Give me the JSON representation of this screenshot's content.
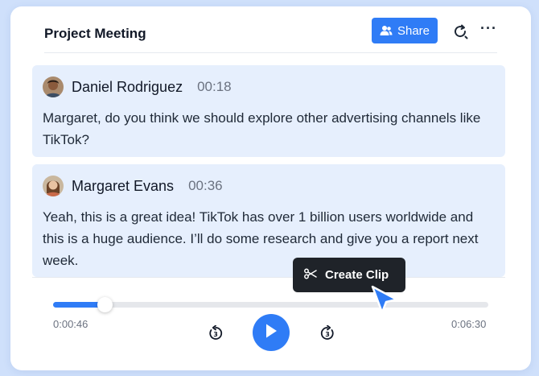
{
  "header": {
    "title": "Project Meeting",
    "share_label": "Share",
    "share_icon": "users-icon",
    "refresh_icon": "refresh-icon",
    "more_icon": "more-horizontal-icon"
  },
  "messages": [
    {
      "name": "Daniel Rodriguez",
      "time": "00:18",
      "text": "Margaret, do you think we should explore other advertising channels like TikTok?"
    },
    {
      "name": "Margaret Evans",
      "time": "00:36",
      "text": "Yeah, this is a great idea! TikTok has over 1 billion users worldwide and this is a huge audience. I’ll do some research and give you a report next week."
    }
  ],
  "tooltip": {
    "label": "Create Clip",
    "icon": "scissors-icon"
  },
  "player": {
    "current_time": "0:00:46",
    "total_time": "0:06:30",
    "progress": 0.118,
    "rewind_icon": "rewind-3-icon",
    "rewind_seconds": "3",
    "forward_icon": "forward-3-icon",
    "forward_seconds": "3",
    "play_icon": "play-icon"
  },
  "colors": {
    "accent": "#2f7cf6",
    "message_bg": "#e6effd",
    "page_bg": "#cfe0fb",
    "tooltip_bg": "#1f2329"
  }
}
